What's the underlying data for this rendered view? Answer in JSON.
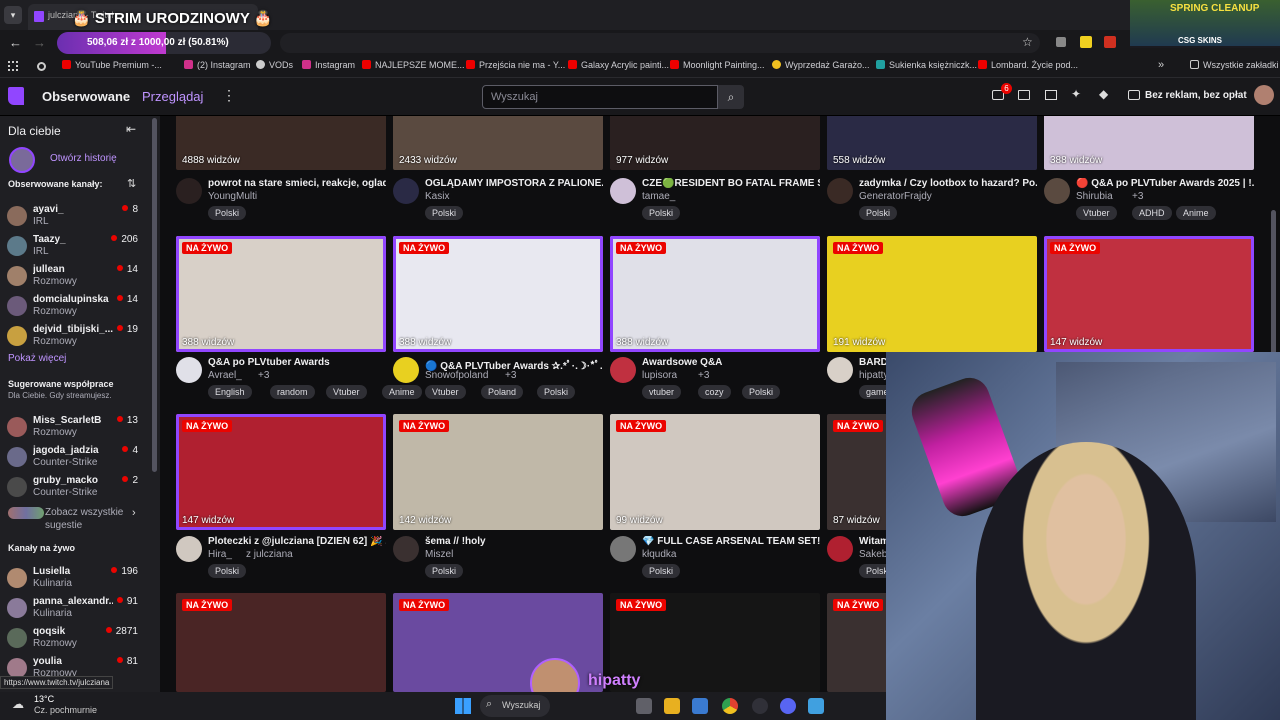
{
  "browser": {
    "tab_title": "julcziana - Twitch",
    "stream_title_overlay": "STRIM URODZINOWY",
    "donation_goal": "508,06 zł z 1000,00 zł (50.81%)",
    "donation_progress": 0.5081,
    "bookmarks": [
      "YouTube Premium -...",
      "(2) Instagram",
      "VODs",
      "Instagram",
      "NAJLEPSZE MOME...",
      "Przejścia nie ma - Y...",
      "Galaxy Acrylic painti...",
      "Moonlight Painting...",
      "Wyprzedaż Garażo...",
      "Sukienka księżniczk...",
      "Lombard. Życie pod...",
      "Wszystkie zakładki"
    ],
    "status_url": "https://www.twitch.tv/julcziana"
  },
  "topnav": {
    "following": "Obserwowane",
    "browse": "Przeglądaj",
    "search_placeholder": "Wyszukaj",
    "notif_count": "6",
    "turbo": "Bez reklam, bez opłat"
  },
  "sidebar": {
    "for_you": "Dla ciebie",
    "open_history": "Otwórz historię",
    "followed_header": "Obserwowane kanały:",
    "followed": [
      {
        "name": "ayavi_",
        "category": "IRL",
        "viewers": "8",
        "color": "#8a6b5c"
      },
      {
        "name": "Taazy_",
        "category": "IRL",
        "viewers": "206",
        "color": "#5c7a8a"
      },
      {
        "name": "jullean",
        "category": "Rozmowy",
        "viewers": "14",
        "color": "#a0806a"
      },
      {
        "name": "domcialupinska",
        "category": "Rozmowy",
        "viewers": "14",
        "color": "#6b5a7a"
      },
      {
        "name": "dejvid_tibijski_...",
        "category": "Rozmowy",
        "viewers": "19",
        "color": "#c8a040"
      }
    ],
    "show_more": "Pokaż więcej",
    "suggested_header": "Sugerowane współprace",
    "suggested_sub": "Dla Ciebie. Gdy streamujesz.",
    "suggested": [
      {
        "name": "Miss_ScarletB",
        "category": "Rozmowy",
        "viewers": "13",
        "color": "#9a5a5a"
      },
      {
        "name": "jagoda_jadzia",
        "category": "Counter-Strike",
        "viewers": "4",
        "color": "#6a6a8a"
      },
      {
        "name": "gruby_macko",
        "category": "Counter-Strike",
        "viewers": "2",
        "color": "#4a4a4a"
      }
    ],
    "see_all": "Zobacz wszystkie sugestie",
    "live_header": "Kanały na żywo",
    "live": [
      {
        "name": "Lusiella",
        "category": "Kulinaria",
        "viewers": "196",
        "color": "#b08a70"
      },
      {
        "name": "panna_alexandr...",
        "category": "Kulinaria",
        "viewers": "91",
        "color": "#8a7a9a"
      },
      {
        "name": "qoqsik",
        "category": "Rozmowy",
        "viewers": "2871",
        "color": "#5a6a5a"
      },
      {
        "name": "youlia",
        "category": "Rozmowy",
        "viewers": "81",
        "color": "#a07a8a"
      }
    ]
  },
  "grid": {
    "live_label": "NA ŻYWO",
    "row0": [
      {
        "viewers": "4888 widzów",
        "title": "powrot na stare smieci, reakcje, oglad...",
        "channel": "YoungMulti",
        "tags": [
          "Polski"
        ]
      },
      {
        "viewers": "2433 widzów",
        "title": "OGLĄDAMY IMPOSTORA Z PALIONE...",
        "channel": "Kasix",
        "tags": [
          "Polski"
        ]
      },
      {
        "viewers": "977 widzów",
        "title": "CZE🟢RESIDENT BO FATAL FRAME S...",
        "channel": "tamae_",
        "tags": [
          "Polski"
        ]
      },
      {
        "viewers": "558 widzów",
        "title": "zadymka / Czy lootbox to hazard? Po...",
        "channel": "GeneratorFrajdy",
        "tags": [
          "Polski"
        ]
      },
      {
        "viewers": "388 widzów",
        "title": "🔴 Q&A po PLVTuber Awards 2025 | !...",
        "channel": "Shirubia",
        "extra": "+3",
        "tags": [
          "Vtuber",
          "ADHD",
          "Anime"
        ]
      }
    ],
    "row1": [
      {
        "viewers": "388 widzów",
        "title": "Q&A po PLVtuber Awards",
        "channel": "Avrael_",
        "extra": "+3",
        "tags": [
          "English",
          "random",
          "Vtuber",
          "Anime"
        ]
      },
      {
        "viewers": "388 widzów",
        "title": "🔵 Q&A PLVTuber Awards ✰.*ﾟ·.☽·*ﾟ...",
        "channel": "Snowofpoland",
        "extra": "+3",
        "tags": [
          "Vtuber",
          "Poland",
          "Polski"
        ]
      },
      {
        "viewers": "388 widzów",
        "title": "Awardsowe Q&A",
        "channel": "lupisora",
        "extra": "+3",
        "tags": [
          "vtuber",
          "cozy",
          "Polski"
        ]
      },
      {
        "viewers": "191 widzów",
        "title": "BARDZ",
        "channel": "hipatty",
        "tags": [
          "game"
        ]
      },
      {
        "viewers": "147 widzów",
        "title": "",
        "channel": "",
        "tags": []
      }
    ],
    "row2": [
      {
        "viewers": "147 widzów",
        "title": "Ploteczki z @julcziana [DZIEŃ 62] 🎉 ...",
        "channel": "Hira_",
        "extra": "z julcziana",
        "tags": [
          "Polski"
        ]
      },
      {
        "viewers": "142 widzów",
        "title": "šema // !holy",
        "channel": "Miszel",
        "tags": [
          "Polski"
        ]
      },
      {
        "viewers": "99 widzów",
        "title": "💎 FULL CASE ARSENAL TEAM SET! B...",
        "channel": "kłqudka",
        "tags": [
          "Polski"
        ]
      },
      {
        "viewers": "87 widzów",
        "title": "Witam",
        "channel": "Sakeb",
        "tags": [
          "Polsk"
        ]
      }
    ]
  },
  "overlay": {
    "name_tag": "hipatty",
    "sponsor": "CSG SKINS",
    "spring": "SPRING CLEANUP"
  },
  "taskbar": {
    "weather_temp": "13°C",
    "weather_desc": "Cz. pochmurnie",
    "search": "Wyszukaj"
  }
}
